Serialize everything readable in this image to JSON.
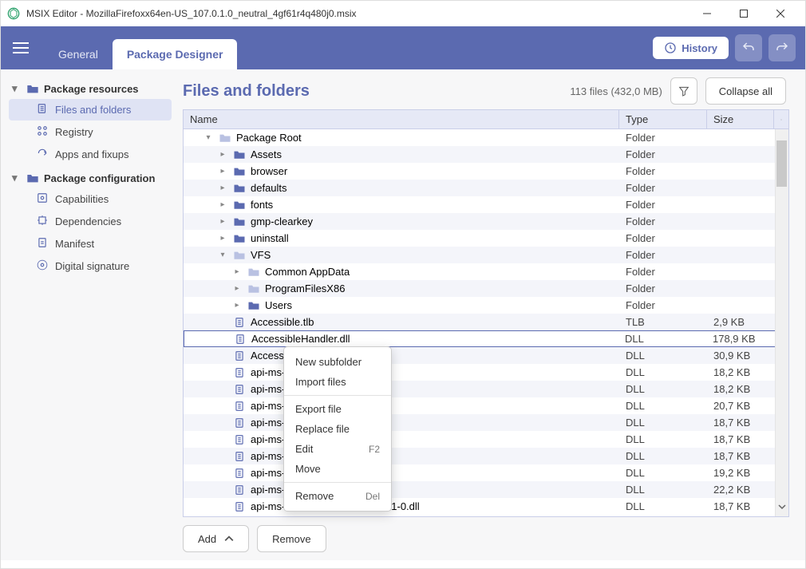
{
  "window": {
    "title": "MSIX Editor - MozillaFirefoxx64en-US_107.0.1.0_neutral_4gf61r4q480j0.msix"
  },
  "ribbon": {
    "tabs": {
      "general": "General",
      "designer": "Package Designer"
    },
    "history": "History"
  },
  "sidebar": {
    "resources_label": "Package resources",
    "files_folders": "Files and folders",
    "registry": "Registry",
    "apps_fixups": "Apps and fixups",
    "config_label": "Package configuration",
    "capabilities": "Capabilities",
    "dependencies": "Dependencies",
    "manifest": "Manifest",
    "signature": "Digital signature"
  },
  "main": {
    "title": "Files and folders",
    "count": "113 files (432,0 MB)",
    "collapse": "Collapse all",
    "cols": {
      "name": "Name",
      "type": "Type",
      "size": "Size"
    },
    "add": "Add",
    "remove": "Remove"
  },
  "rows": [
    {
      "indent": 0,
      "exp": "down",
      "icon": "folder-open",
      "name": "Package Root",
      "type": "Folder",
      "size": ""
    },
    {
      "indent": 1,
      "exp": "right",
      "icon": "folder-closed",
      "name": "Assets",
      "type": "Folder",
      "size": ""
    },
    {
      "indent": 1,
      "exp": "right",
      "icon": "folder-closed",
      "name": "browser",
      "type": "Folder",
      "size": ""
    },
    {
      "indent": 1,
      "exp": "right",
      "icon": "folder-closed",
      "name": "defaults",
      "type": "Folder",
      "size": ""
    },
    {
      "indent": 1,
      "exp": "right",
      "icon": "folder-closed",
      "name": "fonts",
      "type": "Folder",
      "size": ""
    },
    {
      "indent": 1,
      "exp": "right",
      "icon": "folder-closed",
      "name": "gmp-clearkey",
      "type": "Folder",
      "size": ""
    },
    {
      "indent": 1,
      "exp": "right",
      "icon": "folder-closed",
      "name": "uninstall",
      "type": "Folder",
      "size": ""
    },
    {
      "indent": 1,
      "exp": "down",
      "icon": "folder-open",
      "name": "VFS",
      "type": "Folder",
      "size": ""
    },
    {
      "indent": 2,
      "exp": "right",
      "icon": "folder-open",
      "name": "Common AppData",
      "type": "Folder",
      "size": ""
    },
    {
      "indent": 2,
      "exp": "right",
      "icon": "folder-open",
      "name": "ProgramFilesX86",
      "type": "Folder",
      "size": ""
    },
    {
      "indent": 2,
      "exp": "right",
      "icon": "folder-closed",
      "name": "Users",
      "type": "Folder",
      "size": ""
    },
    {
      "indent": 1,
      "exp": "",
      "icon": "file",
      "name": "Accessible.tlb",
      "type": "TLB",
      "size": "2,9 KB"
    },
    {
      "indent": 1,
      "exp": "",
      "icon": "file",
      "name": "AccessibleHandler.dll",
      "type": "DLL",
      "size": "178,9 KB",
      "selected": true
    },
    {
      "indent": 1,
      "exp": "",
      "icon": "file",
      "name": "AccessibleMa",
      "type": "DLL",
      "size": "30,9 KB",
      "cut": true
    },
    {
      "indent": 1,
      "exp": "",
      "icon": "file",
      "name": "api-ms-win-c",
      "type": "DLL",
      "size": "18,2 KB",
      "cut": true
    },
    {
      "indent": 1,
      "exp": "",
      "icon": "file",
      "name": "api-ms-win-c",
      "type": "DLL",
      "size": "18,2 KB",
      "cut": true
    },
    {
      "indent": 1,
      "exp": "",
      "icon": "file",
      "name": "api-ms-win-c",
      "type": "DLL",
      "size": "20,7 KB",
      "cut": true
    },
    {
      "indent": 1,
      "exp": "",
      "icon": "file",
      "name": "api-ms-win-c",
      "type": "DLL",
      "size": "18,7 KB",
      "cut": true
    },
    {
      "indent": 1,
      "exp": "",
      "icon": "file",
      "name": "api-ms-win-c",
      "type": "DLL",
      "size": "18,7 KB",
      "cut": true
    },
    {
      "indent": 1,
      "exp": "",
      "icon": "file",
      "name": "api-ms-win-c",
      "type": "DLL",
      "size": "18,7 KB",
      "cut": true
    },
    {
      "indent": 1,
      "exp": "",
      "icon": "file",
      "name": "api-ms-win-c",
      "type": "DLL",
      "size": "19,2 KB",
      "cut": true
    },
    {
      "indent": 1,
      "exp": "",
      "icon": "file",
      "name": "api-ms-win-c",
      "type": "DLL",
      "size": "22,2 KB",
      "cut": true
    },
    {
      "indent": 1,
      "exp": "",
      "icon": "file",
      "name": "api-ms-win-crt-environment-l1-1-0.dll",
      "type": "DLL",
      "size": "18,7 KB"
    }
  ],
  "context": {
    "new_subfolder": "New subfolder",
    "import_files": "Import files",
    "export_file": "Export file",
    "replace_file": "Replace file",
    "edit": "Edit",
    "edit_short": "F2",
    "move": "Move",
    "remove": "Remove",
    "remove_short": "Del"
  }
}
